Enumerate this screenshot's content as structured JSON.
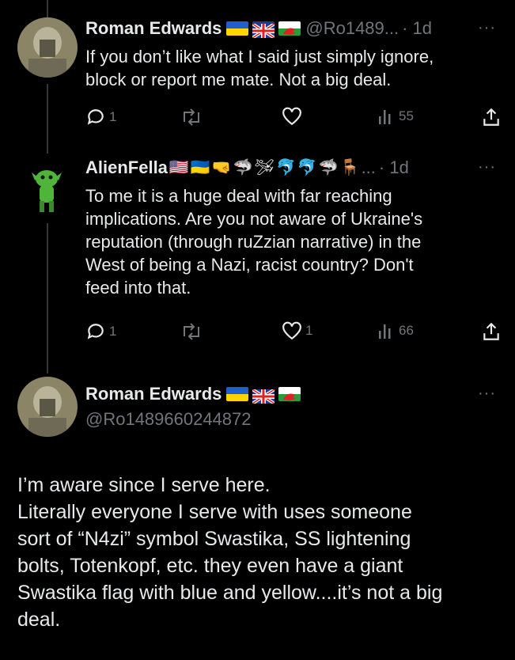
{
  "tweets": [
    {
      "name": "Roman Edwards",
      "handle": "@Ro1489...",
      "time": "· 1d",
      "text_lines": [
        "If you don’t like what I said just simply ignore,",
        "block or report me mate. Not a big deal."
      ],
      "reply_count": "1",
      "retweet_count": "",
      "like_count": "",
      "view_count": "55",
      "flags": [
        "ukraine",
        "uk",
        "wales"
      ]
    },
    {
      "name": "AlienFella",
      "handle": "...",
      "time": "· 1d",
      "text_lines": [
        "To me it is a huge deal with far reaching",
        "implications. Are you not aware of Ukraine's",
        "reputation (through ruZzian narrative) in the",
        "West of being a Nazi, racist country? Don't",
        "feed into that."
      ],
      "reply_count": "1",
      "retweet_count": "",
      "like_count": "1",
      "view_count": "66",
      "emojis": [
        "🇺🇸",
        "🇺🇦",
        "🤜",
        "🦈",
        "🛩",
        "🐬",
        "🐬",
        "🦈",
        "🪑"
      ]
    }
  ],
  "main_tweet": {
    "name": "Roman Edwards",
    "handle": "@Ro1489660244872",
    "flags": [
      "ukraine",
      "uk",
      "wales"
    ],
    "text_lines": [
      "I’m aware since I serve here.",
      "Literally everyone I serve with uses someone",
      "sort of “N4zi” symbol Swastika, SS lightening",
      "bolts, Totenkopf, etc. they even have a giant",
      "Swastika flag with blue and yellow....it’s not a big",
      "deal."
    ]
  },
  "icons": {
    "more": "more-horizontal-icon",
    "reply": "reply-icon",
    "retweet": "retweet-icon",
    "like": "like-icon",
    "views": "views-icon",
    "share": "share-icon"
  },
  "colors": {
    "background": "#000000",
    "text": "#e7e9ea",
    "muted": "#71767b",
    "thread_line": "#333639"
  }
}
